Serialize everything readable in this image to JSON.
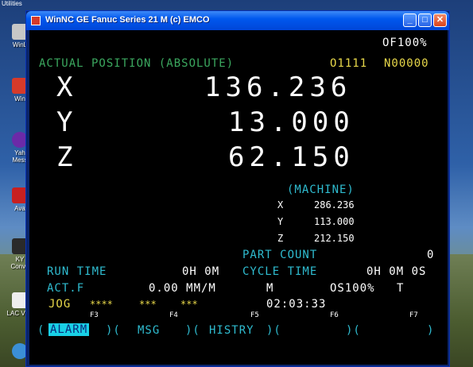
{
  "window": {
    "title": "WinNC GE Fanuc Series 21 M (c) EMCO"
  },
  "header": {
    "override": "OF100%",
    "title": "ACTUAL POSITION (ABSOLUTE)",
    "program": "O1111",
    "block": "N00000"
  },
  "absolute": [
    {
      "axis": "X",
      "value": "136.236"
    },
    {
      "axis": "Y",
      "value": "13.000"
    },
    {
      "axis": "Z",
      "value": "62.150"
    }
  ],
  "machine": {
    "label": "(MACHINE)",
    "rows": [
      {
        "axis": "X",
        "value": "286.236"
      },
      {
        "axis": "Y",
        "value": "113.000"
      },
      {
        "axis": "Z",
        "value": "212.150"
      }
    ]
  },
  "status": {
    "part_count_label": "PART COUNT",
    "part_count_value": "0",
    "run_time_label": "RUN TIME",
    "run_time_value": "0H 0M",
    "cycle_time_label": "CYCLE TIME",
    "cycle_time_value": "0H 0M 0S",
    "actf_label": "ACT.F",
    "actf_value": "0.00 MM/M",
    "m_label": "M",
    "os_value": "OS100%",
    "t_label": "T",
    "mode": "JOG",
    "stars1": "****",
    "stars2": "***",
    "stars3": "***",
    "clock": "02:03:33"
  },
  "softkeys": {
    "f_labels": [
      "F3",
      "F4",
      "F5",
      "F6",
      "F7"
    ],
    "keys": [
      "ALARM",
      "MSG",
      "HISTRY",
      "",
      ""
    ]
  },
  "desktop": {
    "icons": [
      "WinL",
      "Win",
      "Yah Mess",
      "Ava",
      "KY Conve",
      "LAC VI E"
    ],
    "top_text": "Utilities"
  },
  "colors": {
    "green": "#3ba85f",
    "cyan": "#2fbcd0",
    "highlight": "#19d0e6"
  }
}
